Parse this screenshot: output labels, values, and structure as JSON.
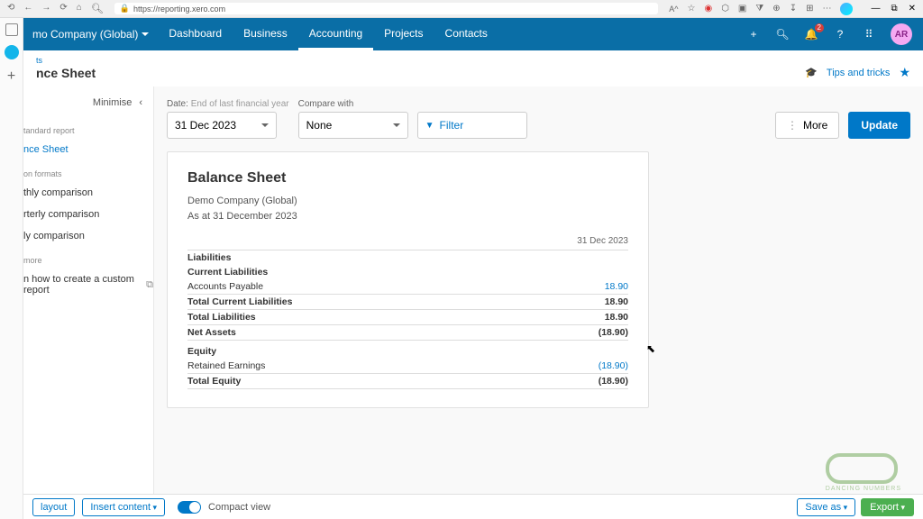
{
  "browser": {
    "url": "https://reporting.xero.com"
  },
  "header": {
    "org": "mo Company (Global)",
    "tabs": [
      "Dashboard",
      "Business",
      "Accounting",
      "Projects",
      "Contacts"
    ],
    "badge": "2",
    "avatar": "AR"
  },
  "titlebar": {
    "breadcrumb": "ts",
    "title": "nce Sheet",
    "tips": "Tips and tricks"
  },
  "sidebar": {
    "minimise": "Minimise",
    "h1": "tandard report",
    "std_item": "nce Sheet",
    "h2": "on formats",
    "formats": [
      "thly comparison",
      "rterly comparison",
      "ly comparison"
    ],
    "h3": "more",
    "learn": "n how to create a custom report"
  },
  "controls": {
    "date_label": "Date:",
    "date_sub": "End of last financial year",
    "date_value": "31 Dec 2023",
    "compare_label": "Compare with",
    "compare_value": "None",
    "filter": "Filter",
    "more": "More",
    "update": "Update"
  },
  "report": {
    "title": "Balance Sheet",
    "company": "Demo Company (Global)",
    "asat": "As at 31 December 2023",
    "col": "31 Dec 2023",
    "rows": {
      "liabilities": "Liabilities",
      "cur_liab": "Current Liabilities",
      "ap": "Accounts Payable",
      "ap_v": "18.90",
      "tcl": "Total Current Liabilities",
      "tcl_v": "18.90",
      "tl": "Total Liabilities",
      "tl_v": "18.90",
      "na": "Net Assets",
      "na_v": "(18.90)",
      "equity": "Equity",
      "re": "Retained Earnings",
      "re_v": "(18.90)",
      "te": "Total Equity",
      "te_v": "(18.90)"
    }
  },
  "bottombar": {
    "layout": "layout",
    "insert": "Insert content",
    "compact": "Compact view",
    "save": "Save as",
    "export": "Export"
  },
  "watermark": "DANCING NUMBERS"
}
